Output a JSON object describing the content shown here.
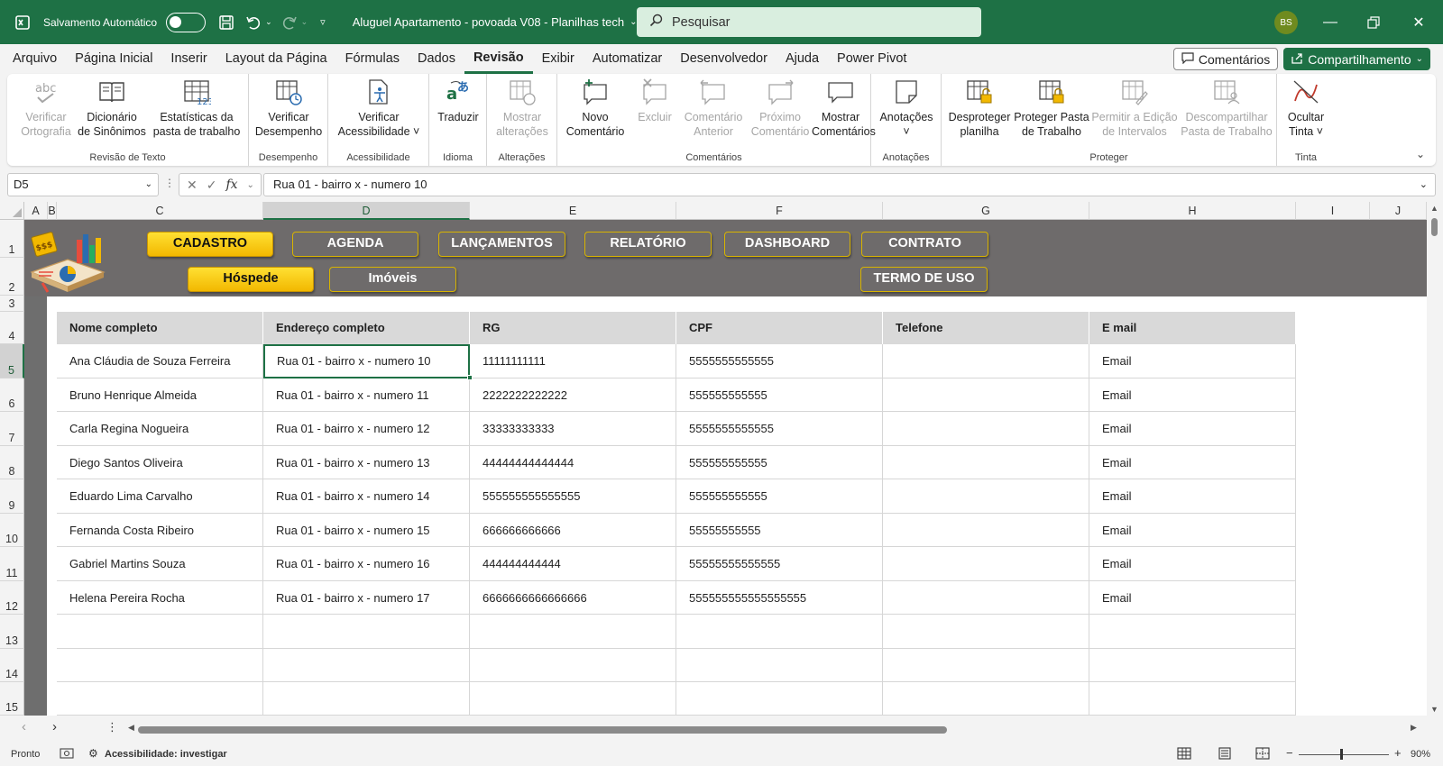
{
  "titlebar": {
    "autosave_label": "Salvamento Automático",
    "doc_title": "Aluguel Apartamento - povoada V08 - Planilhas tech",
    "search_placeholder": "Pesquisar",
    "avatar_initials": "BS"
  },
  "menu": {
    "items": [
      "Arquivo",
      "Página Inicial",
      "Inserir",
      "Layout da Página",
      "Fórmulas",
      "Dados",
      "Revisão",
      "Exibir",
      "Automatizar",
      "Desenvolvedor",
      "Ajuda",
      "Power Pivot"
    ],
    "active": "Revisão",
    "comments_label": "Comentários",
    "share_label": "Compartilhamento"
  },
  "ribbon": {
    "groups": {
      "revisao_texto": "Revisão de Texto",
      "desempenho": "Desempenho",
      "acessibilidade": "Acessibilidade",
      "idioma": "Idioma",
      "alteracoes": "Alterações",
      "comentarios": "Comentários",
      "anotacoes": "Anotações",
      "proteger": "Proteger",
      "tinta": "Tinta"
    },
    "buttons": {
      "verificar_ortografia": [
        "Verificar",
        "Ortografia"
      ],
      "dicionario": [
        "Dicionário",
        "de Sinônimos"
      ],
      "estatisticas": [
        "Estatísticas da",
        "pasta de trabalho"
      ],
      "verificar_desempenho": [
        "Verificar",
        "Desempenho"
      ],
      "verificar_acessibilidade": [
        "Verificar",
        "Acessibilidade ˅"
      ],
      "traduzir": [
        "Traduzir",
        ""
      ],
      "mostrar_alteracoes": [
        "Mostrar",
        "alterações"
      ],
      "novo_comentario": [
        "Novo",
        "Comentário"
      ],
      "excluir": [
        "Excluir",
        ""
      ],
      "comentario_anterior": [
        "Comentário",
        "Anterior"
      ],
      "proximo_comentario": [
        "Próximo",
        "Comentário"
      ],
      "mostrar_comentarios": [
        "Mostrar",
        "Comentários"
      ],
      "anotacoes": [
        "Anotações",
        "˅"
      ],
      "desproteger_planilha": [
        "Desproteger",
        "planilha"
      ],
      "proteger_pasta": [
        "Proteger Pasta",
        "de Trabalho"
      ],
      "permitir_edicao": [
        "Permitir a Edição",
        "de Intervalos"
      ],
      "descompartilhar": [
        "Descompartilhar",
        "Pasta de Trabalho"
      ],
      "ocultar_tinta": [
        "Ocultar",
        "Tinta ˅"
      ]
    }
  },
  "formula_bar": {
    "name_box": "D5",
    "fx_label": "fx",
    "formula": "Rua 01 - bairro x - numero 10"
  },
  "grid": {
    "columns": [
      "A",
      "B",
      "C",
      "D",
      "E",
      "F",
      "G",
      "H",
      "I",
      "J"
    ],
    "rows": [
      "1",
      "2",
      "3",
      "4",
      "5",
      "6",
      "7",
      "8",
      "9",
      "10",
      "11",
      "12",
      "13",
      "14",
      "15"
    ],
    "nav_buttons": [
      "CADASTRO",
      "AGENDA",
      "LANÇAMENTOS",
      "RELATÓRIO",
      "DASHBOARD",
      "CONTRATO"
    ],
    "sub_buttons": [
      "Hóspede",
      "Imóveis",
      "TERMO DE USO"
    ],
    "active_nav": "CADASTRO",
    "active_sub": "Hóspede",
    "table": {
      "headers": [
        "Nome completo",
        "Endereço completo",
        "RG",
        "CPF",
        "Telefone",
        "E mail"
      ],
      "rows": [
        [
          "Ana Cláudia de Souza Ferreira",
          "Rua 01 - bairro x - numero 10",
          "11111111111",
          "5555555555555",
          "",
          "Email"
        ],
        [
          "Bruno Henrique Almeida",
          "Rua 01 - bairro x - numero 11",
          "2222222222222",
          "555555555555",
          "",
          "Email"
        ],
        [
          "Carla Regina Nogueira",
          "Rua 01 - bairro x - numero 12",
          "33333333333",
          "5555555555555",
          "",
          "Email"
        ],
        [
          "Diego Santos Oliveira",
          "Rua 01 - bairro x - numero 13",
          "44444444444444",
          "555555555555",
          "",
          "Email"
        ],
        [
          "Eduardo Lima Carvalho",
          "Rua 01 - bairro x - numero 14",
          "555555555555555",
          "555555555555",
          "",
          "Email"
        ],
        [
          "Fernanda Costa Ribeiro",
          "Rua 01 - bairro x - numero 15",
          "666666666666",
          "55555555555",
          "",
          "Email"
        ],
        [
          "Gabriel Martins Souza",
          "Rua 01 - bairro x - numero 16",
          "444444444444",
          "55555555555555",
          "",
          "Email"
        ],
        [
          "Helena Pereira Rocha",
          "Rua 01 - bairro x - numero 17",
          "6666666666666666",
          "555555555555555555",
          "",
          "Email"
        ]
      ]
    }
  },
  "status": {
    "ready": "Pronto",
    "accessibility": "Acessibilidade: investigar",
    "zoom": "90%"
  },
  "colors": {
    "brand": "#1e7145",
    "banner": "#6e6b6b",
    "active_button": "#f2b800"
  }
}
